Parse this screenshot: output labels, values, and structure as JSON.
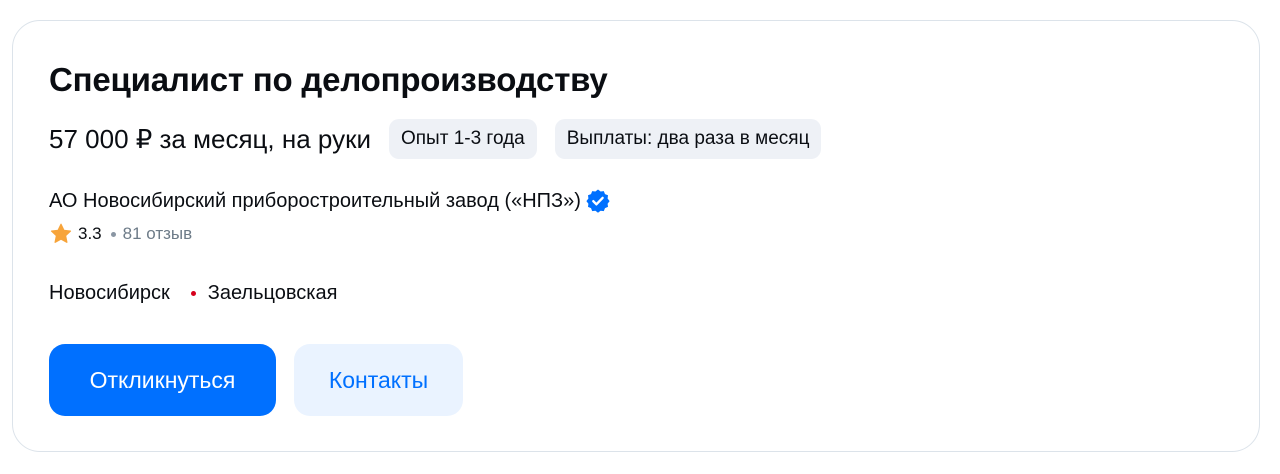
{
  "vacancy": {
    "title": "Специалист по делопроизводству",
    "salary": "57 000 ₽ за месяц, на руки",
    "chips": [
      "Опыт 1-3 года",
      "Выплаты: два раза в месяц"
    ]
  },
  "employer": {
    "name": "АО Новосибирский приборостроительный завод («НПЗ»)",
    "verified_icon": "verified-check-icon",
    "rating": "3.3",
    "reviews": "81 отзыв",
    "star_color": "#f7a43a"
  },
  "location": {
    "city": "Новосибирск",
    "metro": "Заельцовская",
    "metro_color": "#d6001c"
  },
  "actions": {
    "respond_label": "Откликнуться",
    "contacts_label": "Контакты"
  },
  "colors": {
    "accent": "#0070ff",
    "chip_bg": "#eef1f6",
    "secondary_bg": "#eaf3ff"
  }
}
